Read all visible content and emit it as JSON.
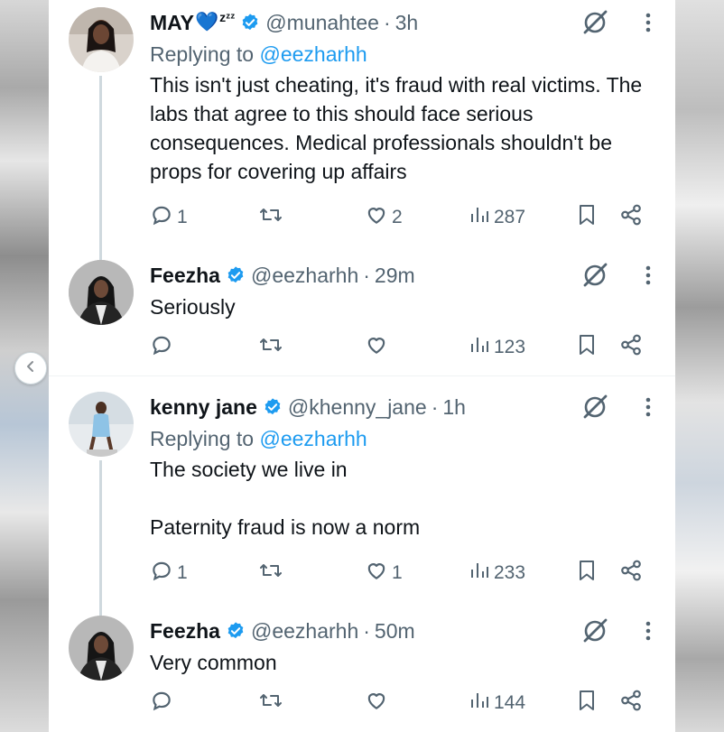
{
  "nav": {
    "prev_icon": "chevron-left-icon"
  },
  "colors": {
    "link": "#1d9bf0",
    "secondary": "#536471",
    "text": "#0f1419"
  },
  "replies": [
    {
      "name": "MAY",
      "name_emoji": "💙",
      "name_suffix": "zᶻᶻ",
      "handle": "@munahtee",
      "time": "3h",
      "replying_label": "Replying to",
      "replying_to": "@eezharhh",
      "text": "This isn't just cheating, it's fraud with real victims. The labs that agree to this should face serious consequences. Medical professionals shouldn't be props for covering up affairs",
      "reply_count": "1",
      "retweet_count": "",
      "like_count": "2",
      "views": "287"
    },
    {
      "name": "Feezha",
      "handle": "@eezharhh",
      "time": "29m",
      "text": "Seriously",
      "reply_count": "",
      "retweet_count": "",
      "like_count": "",
      "views": "123"
    },
    {
      "name": "kenny jane",
      "handle": "@khenny_jane",
      "time": "1h",
      "replying_label": "Replying to",
      "replying_to": "@eezharhh",
      "text": "The society we live in\n\nPaternity fraud is now a norm",
      "reply_count": "1",
      "retweet_count": "",
      "like_count": "1",
      "views": "233"
    },
    {
      "name": "Feezha",
      "handle": "@eezharhh",
      "time": "50m",
      "text": "Very common",
      "reply_count": "",
      "retweet_count": "",
      "like_count": "",
      "views": "144"
    }
  ]
}
